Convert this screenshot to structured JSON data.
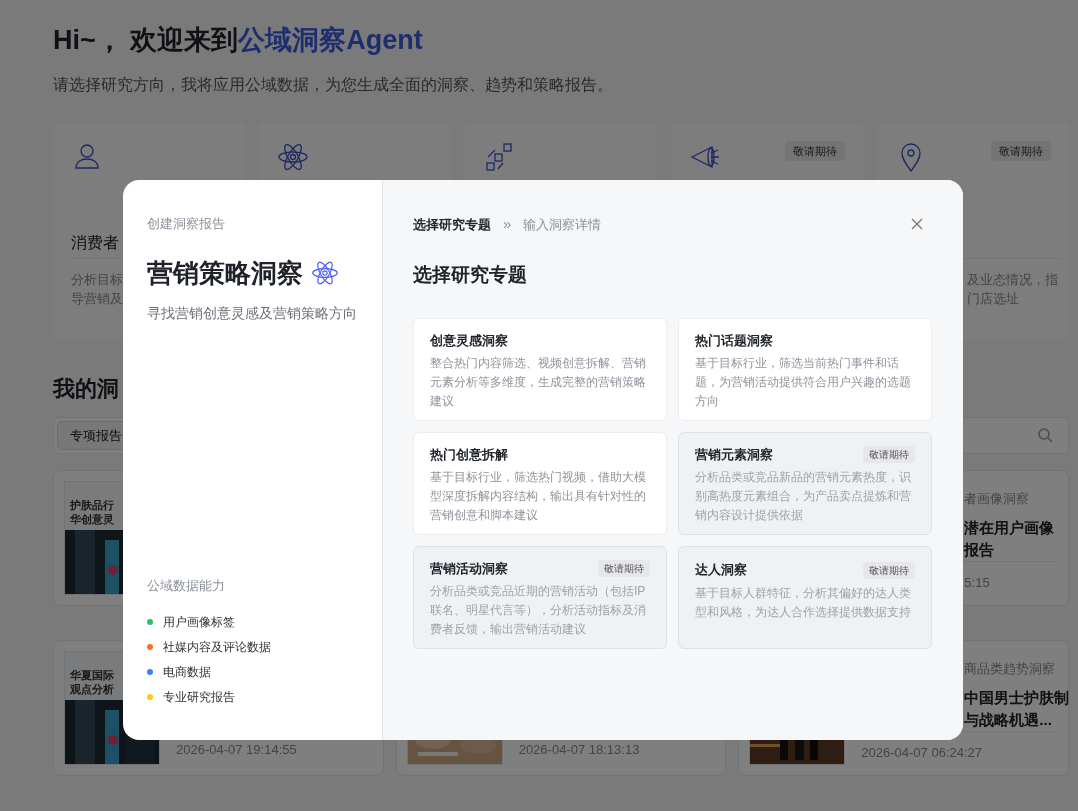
{
  "page": {
    "greeting": "Hi~， 欢迎来到",
    "brand": "公域洞察Agent",
    "subtitle": "请选择研究方向，我将应用公域数据，为您生成全面的洞察、趋势和策略报告。",
    "feature_cards": [
      {
        "title": "消费者",
        "description_lines": [
          "分析目标",
          "导营销及"
        ]
      },
      {
        "badge": "敬请期待"
      },
      {
        "badge": "敬请期待",
        "description_lines": [
          "及业态情况，指",
          "门店选址"
        ]
      }
    ],
    "section_title": "我的洞",
    "tabs": [
      {
        "label": "专项报告",
        "selected": true
      }
    ],
    "reports": [
      {
        "thumbnail_lines": [
          "护肤品行",
          "华创意灵"
        ],
        "photo": true
      },
      {
        "category": "者画像洞察",
        "title_lines": [
          "潜在用户画像",
          "报告"
        ],
        "time": "5:15"
      },
      {
        "thumbnail_lines": [
          "华夏国际",
          "观点分析"
        ],
        "photo": true,
        "time": "2026-04-07 19:14:55"
      },
      {
        "photo": true,
        "time": "2026-04-07 18:13:13"
      },
      {
        "category": "商品类趋势洞察",
        "title_lines": [
          "中国男士护肤制",
          "与战略机遇..."
        ],
        "photo": true,
        "time": "2026-04-07 06:24:27"
      }
    ]
  },
  "modal": {
    "eyebrow": "创建洞察报告",
    "title": "营销策略洞察",
    "subtitle": "寻找营销创意灵感及营销策略方向",
    "capabilities_title": "公域数据能力",
    "capabilities": [
      {
        "label": "用户画像标签",
        "color": "#22c55e"
      },
      {
        "label": "社媒内容及评论数据",
        "color": "#f97316"
      },
      {
        "label": "电商数据",
        "color": "#3b82f6"
      },
      {
        "label": "专业研究报告",
        "color": "#facc15"
      }
    ],
    "steps": [
      {
        "label": "选择研究专题",
        "selected": true
      },
      {
        "label": "输入洞察详情",
        "selected": false
      }
    ],
    "step_separator": "»",
    "heading": "选择研究专题",
    "topics": [
      {
        "title": "创意灵感洞察",
        "description": "整合热门内容筛选、视频创意拆解、营销元素分析等多维度，生成完整的营销策略建议",
        "disabled": false
      },
      {
        "title": "热门话题洞察",
        "description": "基于目标行业，筛选当前热门事件和话题，为营销活动提供符合用户兴趣的选题方向",
        "disabled": false
      },
      {
        "title": "热门创意拆解",
        "description": "基于目标行业，筛选热门视频，借助大模型深度拆解内容结构，输出具有针对性的营销创意和脚本建议",
        "disabled": false
      },
      {
        "title": "营销元素洞察",
        "description": "分析品类或竞品新品的营销元素热度，识别高热度元素组合，为产品卖点提炼和营销内容设计提供依据",
        "badge": "敬请期待",
        "disabled": true
      },
      {
        "title": "营销活动洞察",
        "description": "分析品类或竞品近期的营销活动（包括IP联名、明星代言等），分析活动指标及消费者反馈，输出营销活动建议",
        "badge": "敬请期待",
        "disabled": true
      },
      {
        "title": "达人洞察",
        "description": "基于目标人群特征，分析其偏好的达人类型和风格，为达人合作选择提供数据支持",
        "badge": "敬请期待",
        "disabled": true
      }
    ]
  }
}
